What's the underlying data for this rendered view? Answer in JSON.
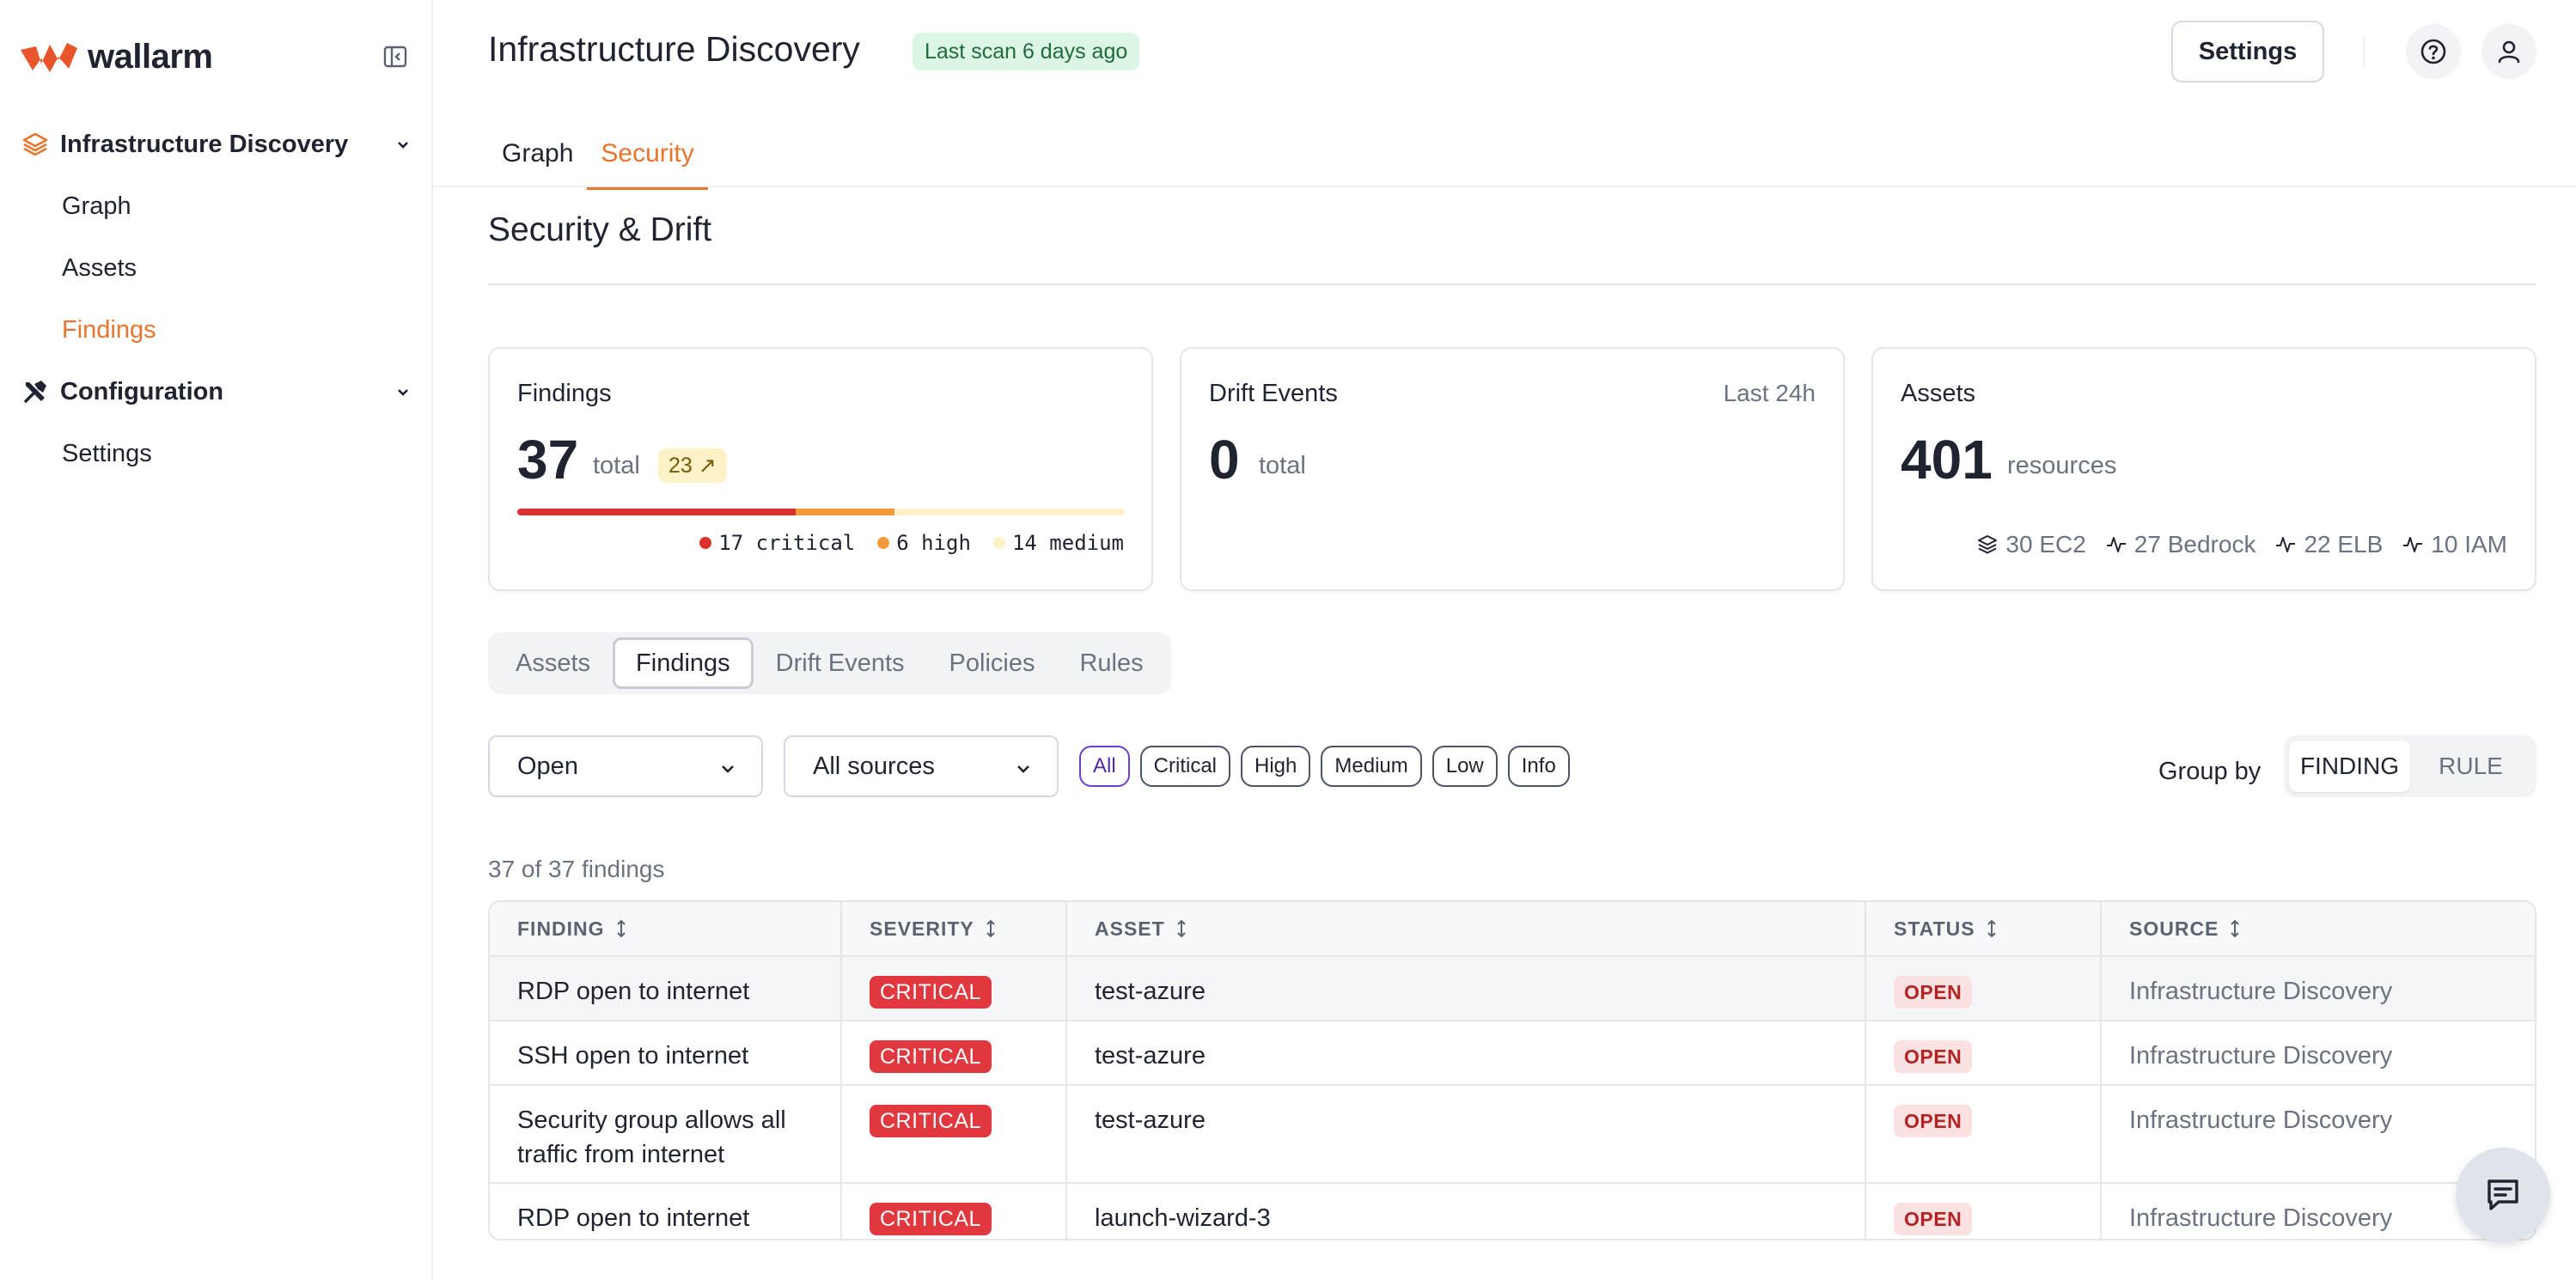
{
  "brand": {
    "name": "wallarm",
    "accent": "#e8742e"
  },
  "sidebar": {
    "groups": [
      {
        "label": "Infrastructure Discovery",
        "icon": "layers-icon",
        "items": [
          "Graph",
          "Assets",
          "Findings"
        ],
        "active_item": "Findings"
      },
      {
        "label": "Configuration",
        "icon": "tools-icon",
        "items": [
          "Settings"
        ]
      }
    ]
  },
  "header": {
    "title": "Infrastructure Discovery",
    "scan_badge": "Last scan 6 days ago",
    "settings_label": "Settings",
    "tabs": [
      "Graph",
      "Security"
    ],
    "active_tab": "Security"
  },
  "section": {
    "title": "Security & Drift"
  },
  "cards": {
    "findings": {
      "title": "Findings",
      "total": "37",
      "unit": "total",
      "trend": "23 ↗",
      "breakdown": [
        {
          "label": "17 critical",
          "count": 17,
          "color": "#dc2f2f"
        },
        {
          "label": "6 high",
          "count": 6,
          "color": "#f29a38"
        },
        {
          "label": "14 medium",
          "count": 14,
          "color": "#fdf1c8"
        }
      ]
    },
    "drift": {
      "title": "Drift Events",
      "period": "Last 24h",
      "total": "0",
      "unit": "total"
    },
    "assets": {
      "title": "Assets",
      "total": "401",
      "unit": "resources",
      "breakdown": [
        {
          "label": "30 EC2",
          "icon": "layers-icon"
        },
        {
          "label": "27 Bedrock",
          "icon": "activity-icon"
        },
        {
          "label": "22 ELB",
          "icon": "activity-icon"
        },
        {
          "label": "10 IAM",
          "icon": "activity-icon"
        }
      ]
    }
  },
  "subtabs": [
    "Assets",
    "Findings",
    "Drift Events",
    "Policies",
    "Rules"
  ],
  "active_subtab": "Findings",
  "filters": {
    "status_value": "Open",
    "source_value": "All sources",
    "severity_chips": [
      "All",
      "Critical",
      "High",
      "Medium",
      "Low",
      "Info"
    ],
    "active_chip": "All",
    "group_by_label": "Group by",
    "group_by_options": [
      "FINDING",
      "RULE"
    ],
    "group_by_active": "FINDING"
  },
  "count_text": "37 of 37 findings",
  "table": {
    "columns": [
      "FINDING",
      "SEVERITY",
      "ASSET",
      "STATUS",
      "SOURCE"
    ],
    "rows": [
      {
        "finding": "RDP open to internet",
        "severity": "CRITICAL",
        "asset": "test-azure",
        "status": "OPEN",
        "source": "Infrastructure Discovery"
      },
      {
        "finding": "SSH open to internet",
        "severity": "CRITICAL",
        "asset": "test-azure",
        "status": "OPEN",
        "source": "Infrastructure Discovery"
      },
      {
        "finding": "Security group allows all traffic from internet",
        "severity": "CRITICAL",
        "asset": "test-azure",
        "status": "OPEN",
        "source": "Infrastructure Discovery"
      },
      {
        "finding": "RDP open to internet",
        "severity": "CRITICAL",
        "asset": "launch-wizard-3",
        "status": "OPEN",
        "source": "Infrastructure Discovery"
      }
    ]
  }
}
